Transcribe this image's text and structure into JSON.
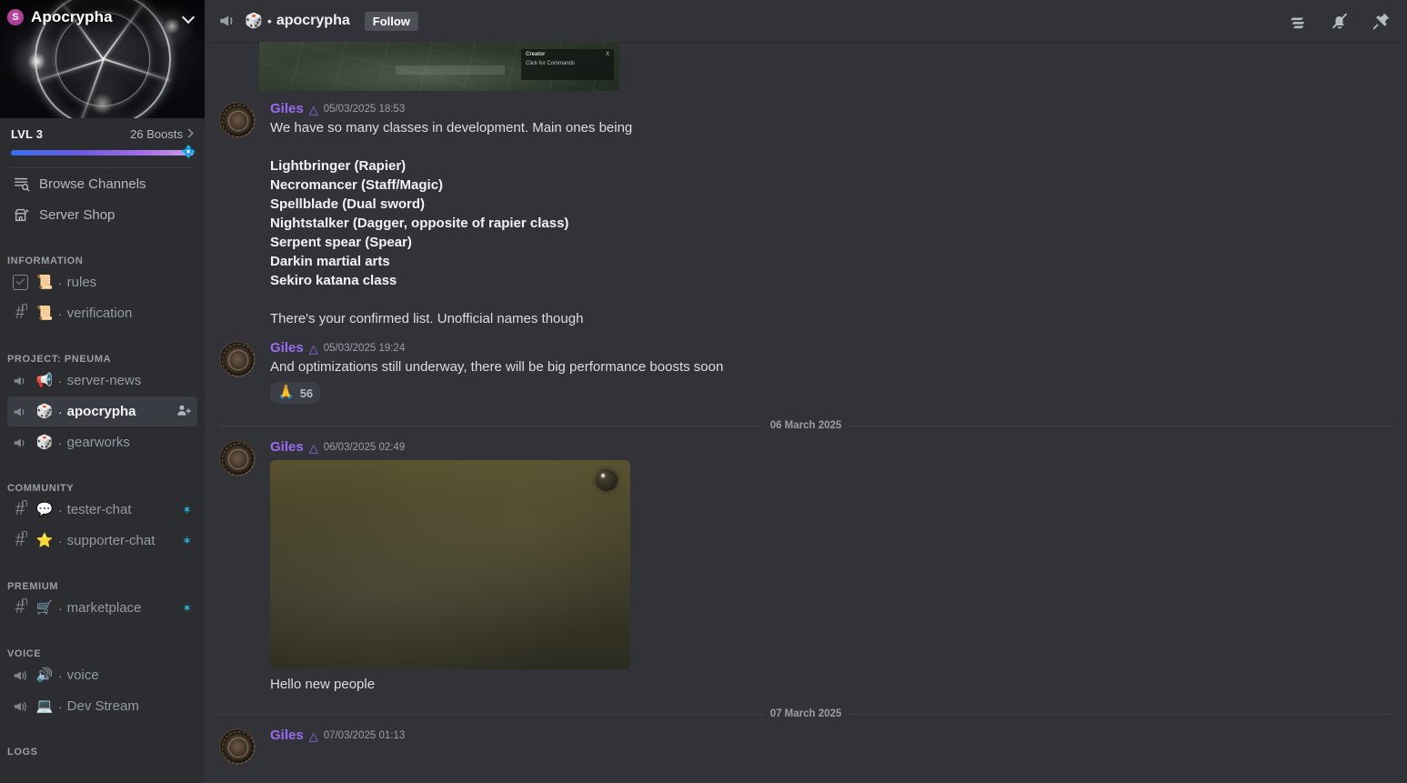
{
  "sidebar": {
    "server": {
      "name": "Apocrypha",
      "badge_glyph": "S",
      "chevron_icon": "chevron-down-icon"
    },
    "boost": {
      "level_label": "LVL 3",
      "boosts_label": "26 Boosts",
      "tip_emoji": "💠"
    },
    "nav": [
      {
        "label": "Browse Channels",
        "icon": "browse-channels-icon"
      },
      {
        "label": "Server Shop",
        "icon": "server-shop-icon"
      }
    ],
    "categories": [
      {
        "label": "INFORMATION",
        "channels": [
          {
            "name": "rules",
            "type": "rules",
            "emoji": "📜",
            "trail": "",
            "active": false
          },
          {
            "name": "verification",
            "type": "text-locked",
            "emoji": "📜",
            "trail": "",
            "active": false
          }
        ]
      },
      {
        "label": "PROJECT: PNEUMA",
        "channels": [
          {
            "name": "server-news",
            "type": "announcement",
            "emoji": "📢",
            "trail": "",
            "active": false
          },
          {
            "name": "apocrypha",
            "type": "announcement",
            "emoji": "🎲",
            "trail": "add-members-icon",
            "active": true
          },
          {
            "name": "gearworks",
            "type": "announcement",
            "emoji": "🎲",
            "trail": "",
            "active": false
          }
        ]
      },
      {
        "label": "COMMUNITY",
        "channels": [
          {
            "name": "tester-chat",
            "type": "text-locked",
            "emoji": "💬",
            "trail": "sparkle",
            "active": false
          },
          {
            "name": "supporter-chat",
            "type": "text-locked",
            "emoji": "⭐",
            "trail": "sparkle",
            "active": false
          }
        ]
      },
      {
        "label": "PREMIUM",
        "channels": [
          {
            "name": "marketplace",
            "type": "text-locked",
            "emoji": "🛒",
            "trail": "sparkle",
            "active": false
          }
        ]
      },
      {
        "label": "VOICE",
        "channels": [
          {
            "name": "voice",
            "type": "voice",
            "emoji": "🔊",
            "trail": "",
            "active": false
          },
          {
            "name": "Dev Stream",
            "type": "voice",
            "emoji": "💻",
            "trail": "",
            "active": false
          }
        ]
      },
      {
        "label": "LOGS",
        "channels": []
      }
    ]
  },
  "topbar": {
    "channel_emoji": "🎲",
    "channel_dot": "•",
    "channel_name": "apocrypha",
    "follow_label": "Follow",
    "icons": [
      "threads-icon",
      "bell-muted-icon",
      "pin-icon"
    ]
  },
  "messages": {
    "cut_image": {
      "overlay_title": "Creator",
      "overlay_sub": "Click for Commands",
      "overlay_close": "X"
    },
    "items": [
      {
        "author": "Giles",
        "role_icon": "role-badge-icon",
        "timestamp": "05/03/2025 18:53",
        "lines": [
          {
            "text": "We have so many classes in development. Main ones being",
            "bold": false
          },
          {
            "text": "",
            "bold": false
          },
          {
            "text": "Lightbringer (Rapier)",
            "bold": true
          },
          {
            "text": "Necromancer (Staff/Magic)",
            "bold": true
          },
          {
            "text": "Spellblade (Dual sword)",
            "bold": true
          },
          {
            "text": "Nightstalker (Dagger, opposite of rapier class)",
            "bold": true
          },
          {
            "text": "Serpent spear (Spear)",
            "bold": true
          },
          {
            "text": "Darkin martial arts",
            "bold": true
          },
          {
            "text": "Sekiro katana class",
            "bold": true
          },
          {
            "text": "",
            "bold": false
          },
          {
            "text": "There's your confirmed list. Unofficial names though",
            "bold": false
          }
        ],
        "reactions": []
      },
      {
        "author": "Giles",
        "role_icon": "role-badge-icon",
        "timestamp": "05/03/2025 19:24",
        "lines": [
          {
            "text": "And optimizations still underway, there will be big performance boosts soon",
            "bold": false
          }
        ],
        "reactions": [
          {
            "emoji": "🙏",
            "count": "56"
          }
        ]
      }
    ],
    "divider_1": "06 March 2025",
    "message_3": {
      "author": "Giles",
      "role_icon": "role-badge-icon",
      "timestamp": "06/03/2025 02:49",
      "caption": "Hello new people"
    },
    "divider_2": "07 March 2025",
    "message_4": {
      "author": "Giles",
      "role_icon": "role-badge-icon",
      "timestamp": "07/03/2025 01:13"
    }
  },
  "colors": {
    "accent_author": "#9b6bf0",
    "sparkle": "#23b6d6",
    "sidebar_bg": "#2b2d31",
    "main_bg": "#323339",
    "active_channel_bg": "#3a3c43"
  }
}
